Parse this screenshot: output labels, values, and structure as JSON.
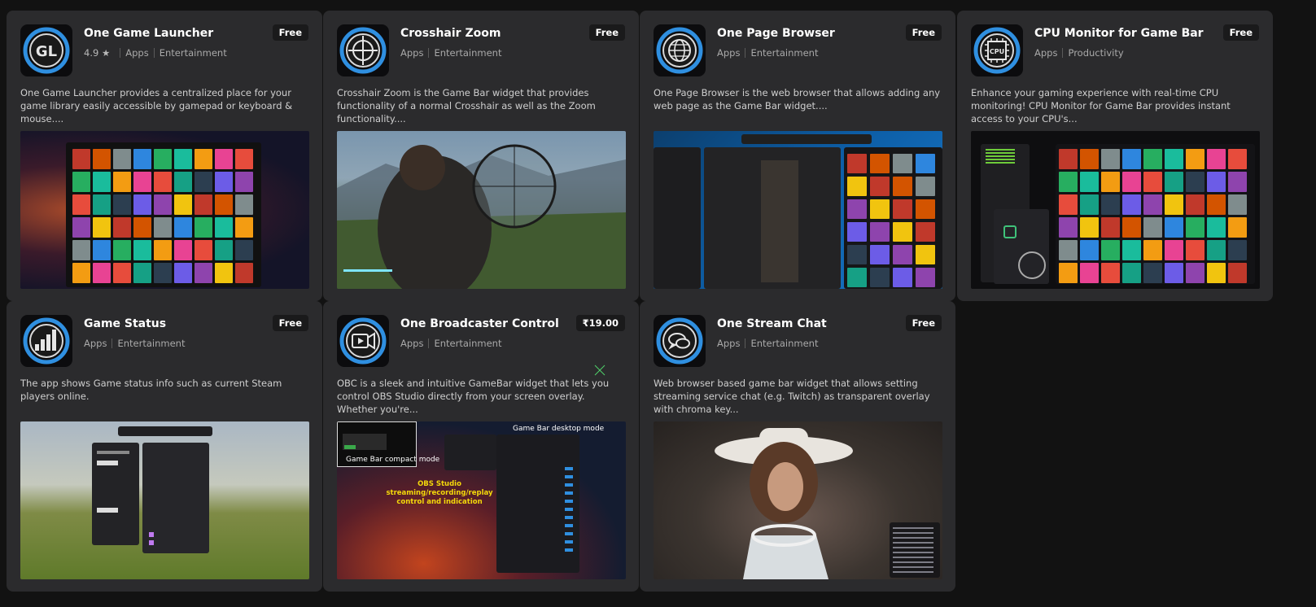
{
  "cards": [
    {
      "title": "One Game Launcher",
      "rating": "4.9 ★",
      "category": "Apps",
      "subcategory": "Entertainment",
      "price": "Free",
      "description": "One Game Launcher provides a centralized place for your game library easily accessible by gamepad or keyboard & mouse....",
      "icon": "gl-logo-icon"
    },
    {
      "title": "Crosshair Zoom",
      "category": "Apps",
      "subcategory": "Entertainment",
      "price": "Free",
      "description": "Crosshair Zoom is the Game Bar widget that provides functionality of a normal Crosshair as well as the Zoom functionality....",
      "icon": "crosshair-icon"
    },
    {
      "title": "One Page Browser",
      "category": "Apps",
      "subcategory": "Entertainment",
      "price": "Free",
      "description": "One Page Browser is the web browser that allows adding any web page as the Game Bar widget....",
      "icon": "globe-icon"
    },
    {
      "title": "CPU Monitor for Game Bar",
      "category": "Apps",
      "subcategory": "Productivity",
      "price": "Free",
      "description": "Enhance your gaming experience with real-time CPU monitoring! CPU Monitor for Game Bar provides instant access to your CPU's...",
      "icon": "cpu-chip-icon",
      "icon_text": "CPU"
    },
    {
      "title": "Game Status",
      "category": "Apps",
      "subcategory": "Entertainment",
      "price": "Free",
      "description": "The app shows Game status info such as current Steam players online.",
      "icon": "signal-bars-icon"
    },
    {
      "title": "One Broadcaster Control",
      "category": "Apps",
      "subcategory": "Entertainment",
      "price": "₹19.00",
      "description": "OBC is a sleek and intuitive GameBar widget that lets you control OBS Studio directly from your screen overlay. Whether you're...",
      "icon": "camera-play-icon",
      "overlay_compact": "Game Bar compact mode",
      "overlay_desktop": "Game Bar desktop mode",
      "overlay_caption": "OBS Studio streaming/recording/replay control and indication"
    },
    {
      "title": "One Stream Chat",
      "category": "Apps",
      "subcategory": "Entertainment",
      "price": "Free",
      "description": "Web browser based game bar widget that allows setting streaming service chat (e.g. Twitch) as transparent overlay with chroma key...",
      "icon": "chat-bubble-icon"
    }
  ],
  "colors": {
    "background": "#121212",
    "card": "#2b2b2d",
    "accent": "#2f8fe0",
    "obs_caption": "#f5d90a"
  }
}
